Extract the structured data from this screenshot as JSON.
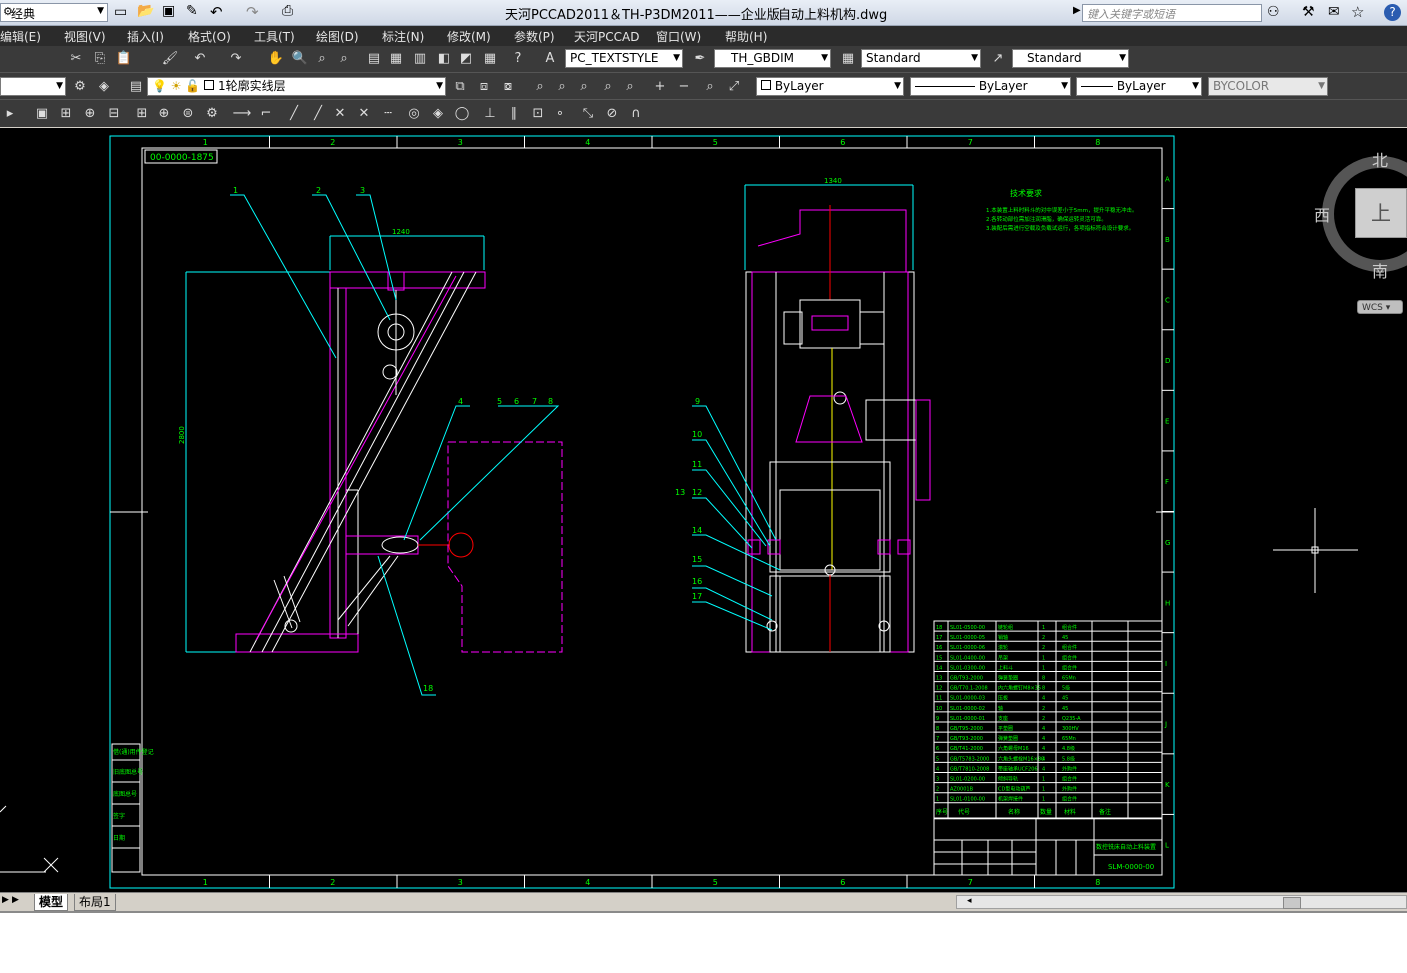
{
  "titlebar": {
    "workspace": "经典",
    "title": "天河PCCAD2011＆TH-P3DM2011——企业版",
    "filename": "自动上料机构.dwg",
    "search_placeholder": "键入关键字或短语"
  },
  "menu": [
    "编辑(E)",
    "视图(V)",
    "插入(I)",
    "格式(O)",
    "工具(T)",
    "绘图(D)",
    "标注(N)",
    "修改(M)",
    "参数(P)",
    "天河PCCAD",
    "窗口(W)",
    "帮助(H)"
  ],
  "toolbar1": {
    "text_style": "PC_TEXTSTYLE",
    "dim_style": "TH_GBDIM",
    "table_style": "Standard",
    "multileader_style": "Standard"
  },
  "toolbar2": {
    "layer": "1轮廓实线层",
    "color": "ByLayer",
    "linetype": "ByLayer",
    "lineweight": "ByLayer",
    "plotstyle": "BYCOLOR"
  },
  "viewcube": {
    "north": "北",
    "west": "西",
    "south": "南",
    "top": "上",
    "wcs": "WCS"
  },
  "drawing": {
    "frame_code": "00-0000-1875",
    "col_labels": [
      "1",
      "2",
      "3",
      "4",
      "5",
      "6",
      "7",
      "8"
    ],
    "row_labels": [
      "A",
      "B",
      "C",
      "D",
      "E",
      "F",
      "G",
      "H",
      "I",
      "J",
      "K",
      "L"
    ],
    "balloons_left": [
      "1",
      "2",
      "3",
      "4",
      "5",
      "6",
      "7",
      "8",
      "18"
    ],
    "balloons_right": [
      "9",
      "10",
      "11",
      "12",
      "13",
      "14",
      "15",
      "16",
      "17"
    ],
    "dim_width_left": "1240",
    "dim_width_right": "1340",
    "dim_height": "2800",
    "tech_req_title": "技术要求",
    "tech_req_lines": [
      "1.本装置上料时料斗的对中误差小于5mm，提升平稳无冲击。",
      "2.各转动部位需加注润滑脂，确保运转灵活可靠。",
      "3.装配后需进行空载及负载试运行，各项指标符合设计要求。"
    ],
    "bom_rows": [
      [
        "18",
        "SL01-0500-00",
        "链轮组",
        "1",
        "组合件"
      ],
      [
        "17",
        "SL01-0000-05",
        "销轴",
        "2",
        "45"
      ],
      [
        "16",
        "SL01-0000-06",
        "滚轮",
        "2",
        "组合件"
      ],
      [
        "15",
        "SL01-0400-00",
        "吊架",
        "1",
        "组合件"
      ],
      [
        "14",
        "SL01-0300-00",
        "上料斗",
        "1",
        "组合件"
      ],
      [
        "13",
        "GB/T93-2000",
        "弹簧垫圈",
        "8",
        "65Mn"
      ],
      [
        "12",
        "GB/T70.1-2008",
        "内六角螺钉M8×35",
        "8",
        "5级"
      ],
      [
        "11",
        "SL01-0000-03",
        "压板",
        "4",
        "45"
      ],
      [
        "10",
        "SL01-0000-02",
        "轴",
        "2",
        "45"
      ],
      [
        "9",
        "SL01-0000-01",
        "支座",
        "2",
        "Q235-A"
      ],
      [
        "8",
        "GB/T95-2000",
        "平垫圈",
        "4",
        "300HV"
      ],
      [
        "7",
        "GB/T93-2000",
        "弹簧垫圈",
        "4",
        "65Mn"
      ],
      [
        "6",
        "GB/T41-2000",
        "六角螺母M16",
        "4",
        "4.8级"
      ],
      [
        "5",
        "GB/T5783-2000",
        "六角头螺栓M16×80",
        "4",
        "5.8级"
      ],
      [
        "4",
        "GB/T7810-2008",
        "带座轴承UCF206",
        "4",
        "外购件"
      ],
      [
        "3",
        "SL01-0200-00",
        "倾斜导轨",
        "1",
        "组合件"
      ],
      [
        "2",
        "AZ0001B",
        "CD型电动葫芦",
        "1",
        "外购件"
      ],
      [
        "1",
        "SL01-0100-00",
        "机架焊接件",
        "1",
        "组合件"
      ]
    ],
    "bom_header": [
      "序号",
      "代号",
      "名称",
      "数量",
      "材料",
      "备注"
    ],
    "title_block_name": "数控铣床自动上料装置",
    "title_block_code": "SLM-0000-00",
    "left_strip": [
      "借(通)用件登记",
      "旧底图总号",
      "底图总号",
      "签字",
      "日期"
    ]
  },
  "tabs": [
    "模型",
    "布局1"
  ]
}
